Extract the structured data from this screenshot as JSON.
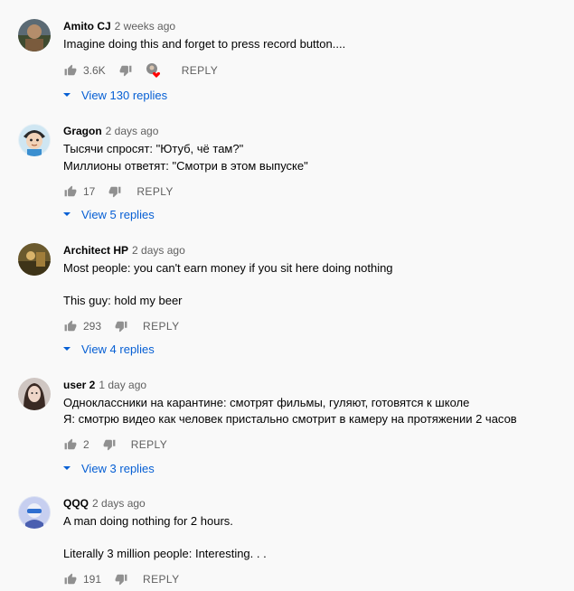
{
  "comments": [
    {
      "author": "Amito CJ",
      "time": "2 weeks ago",
      "lines": [
        "Imagine doing this and forget to press record button...."
      ],
      "likes": "3.6K",
      "hearted": true,
      "reply_label": "REPLY",
      "view_replies": "View 130 replies"
    },
    {
      "author": "Gragon",
      "time": "2 days ago",
      "lines": [
        "Тысячи спросят: \"Ютуб, чё там?\"",
        "Миллионы ответят: \"Смотри в этом выпуске\""
      ],
      "likes": "17",
      "hearted": false,
      "reply_label": "REPLY",
      "view_replies": "View 5 replies"
    },
    {
      "author": "Architect HP",
      "time": "2 days ago",
      "lines": [
        "Most people: you can't earn money if you sit here doing nothing",
        "",
        "This guy: hold my beer"
      ],
      "likes": "293",
      "hearted": false,
      "reply_label": "REPLY",
      "view_replies": "View 4 replies"
    },
    {
      "author": "user 2",
      "time": "1 day ago",
      "lines": [
        "Одноклассники на карантине: смотрят фильмы, гуляют, готовятся к школе",
        "Я: смотрю видео как человек пристально смотрит в камеру на протяжении 2 часов"
      ],
      "likes": "2",
      "hearted": false,
      "reply_label": "REPLY",
      "view_replies": "View 3 replies"
    },
    {
      "author": "QQQ",
      "time": "2 days ago",
      "lines": [
        "A man doing nothing for 2 hours.",
        "",
        "Literally 3 million people: Interesting. . ."
      ],
      "likes": "191",
      "hearted": false,
      "reply_label": "REPLY",
      "view_replies": ""
    }
  ],
  "colors": {
    "link": "#065fd4",
    "muted": "#606060",
    "heart": "#ff0000",
    "background": "#f9f9f9"
  },
  "icons": {
    "like": "thumbs-up-icon",
    "dislike": "thumbs-down-icon",
    "heart": "creator-heart-icon",
    "expand": "chevron-down-icon"
  }
}
